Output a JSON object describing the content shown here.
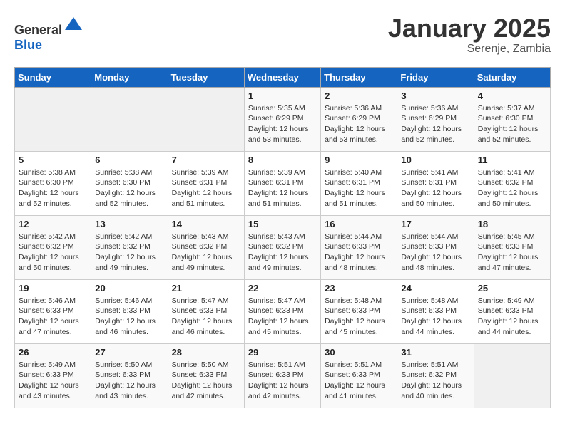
{
  "header": {
    "logo_general": "General",
    "logo_blue": "Blue",
    "month": "January 2025",
    "location": "Serenje, Zambia"
  },
  "weekdays": [
    "Sunday",
    "Monday",
    "Tuesday",
    "Wednesday",
    "Thursday",
    "Friday",
    "Saturday"
  ],
  "weeks": [
    [
      {
        "day": "",
        "empty": true
      },
      {
        "day": "",
        "empty": true
      },
      {
        "day": "",
        "empty": true
      },
      {
        "day": "1",
        "sunrise": "5:35 AM",
        "sunset": "6:29 PM",
        "daylight": "12 hours and 53 minutes."
      },
      {
        "day": "2",
        "sunrise": "5:36 AM",
        "sunset": "6:29 PM",
        "daylight": "12 hours and 53 minutes."
      },
      {
        "day": "3",
        "sunrise": "5:36 AM",
        "sunset": "6:29 PM",
        "daylight": "12 hours and 52 minutes."
      },
      {
        "day": "4",
        "sunrise": "5:37 AM",
        "sunset": "6:30 PM",
        "daylight": "12 hours and 52 minutes."
      }
    ],
    [
      {
        "day": "5",
        "sunrise": "5:38 AM",
        "sunset": "6:30 PM",
        "daylight": "12 hours and 52 minutes."
      },
      {
        "day": "6",
        "sunrise": "5:38 AM",
        "sunset": "6:30 PM",
        "daylight": "12 hours and 52 minutes."
      },
      {
        "day": "7",
        "sunrise": "5:39 AM",
        "sunset": "6:31 PM",
        "daylight": "12 hours and 51 minutes."
      },
      {
        "day": "8",
        "sunrise": "5:39 AM",
        "sunset": "6:31 PM",
        "daylight": "12 hours and 51 minutes."
      },
      {
        "day": "9",
        "sunrise": "5:40 AM",
        "sunset": "6:31 PM",
        "daylight": "12 hours and 51 minutes."
      },
      {
        "day": "10",
        "sunrise": "5:41 AM",
        "sunset": "6:31 PM",
        "daylight": "12 hours and 50 minutes."
      },
      {
        "day": "11",
        "sunrise": "5:41 AM",
        "sunset": "6:32 PM",
        "daylight": "12 hours and 50 minutes."
      }
    ],
    [
      {
        "day": "12",
        "sunrise": "5:42 AM",
        "sunset": "6:32 PM",
        "daylight": "12 hours and 50 minutes."
      },
      {
        "day": "13",
        "sunrise": "5:42 AM",
        "sunset": "6:32 PM",
        "daylight": "12 hours and 49 minutes."
      },
      {
        "day": "14",
        "sunrise": "5:43 AM",
        "sunset": "6:32 PM",
        "daylight": "12 hours and 49 minutes."
      },
      {
        "day": "15",
        "sunrise": "5:43 AM",
        "sunset": "6:32 PM",
        "daylight": "12 hours and 49 minutes."
      },
      {
        "day": "16",
        "sunrise": "5:44 AM",
        "sunset": "6:33 PM",
        "daylight": "12 hours and 48 minutes."
      },
      {
        "day": "17",
        "sunrise": "5:44 AM",
        "sunset": "6:33 PM",
        "daylight": "12 hours and 48 minutes."
      },
      {
        "day": "18",
        "sunrise": "5:45 AM",
        "sunset": "6:33 PM",
        "daylight": "12 hours and 47 minutes."
      }
    ],
    [
      {
        "day": "19",
        "sunrise": "5:46 AM",
        "sunset": "6:33 PM",
        "daylight": "12 hours and 47 minutes."
      },
      {
        "day": "20",
        "sunrise": "5:46 AM",
        "sunset": "6:33 PM",
        "daylight": "12 hours and 46 minutes."
      },
      {
        "day": "21",
        "sunrise": "5:47 AM",
        "sunset": "6:33 PM",
        "daylight": "12 hours and 46 minutes."
      },
      {
        "day": "22",
        "sunrise": "5:47 AM",
        "sunset": "6:33 PM",
        "daylight": "12 hours and 45 minutes."
      },
      {
        "day": "23",
        "sunrise": "5:48 AM",
        "sunset": "6:33 PM",
        "daylight": "12 hours and 45 minutes."
      },
      {
        "day": "24",
        "sunrise": "5:48 AM",
        "sunset": "6:33 PM",
        "daylight": "12 hours and 44 minutes."
      },
      {
        "day": "25",
        "sunrise": "5:49 AM",
        "sunset": "6:33 PM",
        "daylight": "12 hours and 44 minutes."
      }
    ],
    [
      {
        "day": "26",
        "sunrise": "5:49 AM",
        "sunset": "6:33 PM",
        "daylight": "12 hours and 43 minutes."
      },
      {
        "day": "27",
        "sunrise": "5:50 AM",
        "sunset": "6:33 PM",
        "daylight": "12 hours and 43 minutes."
      },
      {
        "day": "28",
        "sunrise": "5:50 AM",
        "sunset": "6:33 PM",
        "daylight": "12 hours and 42 minutes."
      },
      {
        "day": "29",
        "sunrise": "5:51 AM",
        "sunset": "6:33 PM",
        "daylight": "12 hours and 42 minutes."
      },
      {
        "day": "30",
        "sunrise": "5:51 AM",
        "sunset": "6:33 PM",
        "daylight": "12 hours and 41 minutes."
      },
      {
        "day": "31",
        "sunrise": "5:51 AM",
        "sunset": "6:32 PM",
        "daylight": "12 hours and 40 minutes."
      },
      {
        "day": "",
        "empty": true
      }
    ]
  ],
  "labels": {
    "sunrise": "Sunrise:",
    "sunset": "Sunset:",
    "daylight": "Daylight:"
  }
}
